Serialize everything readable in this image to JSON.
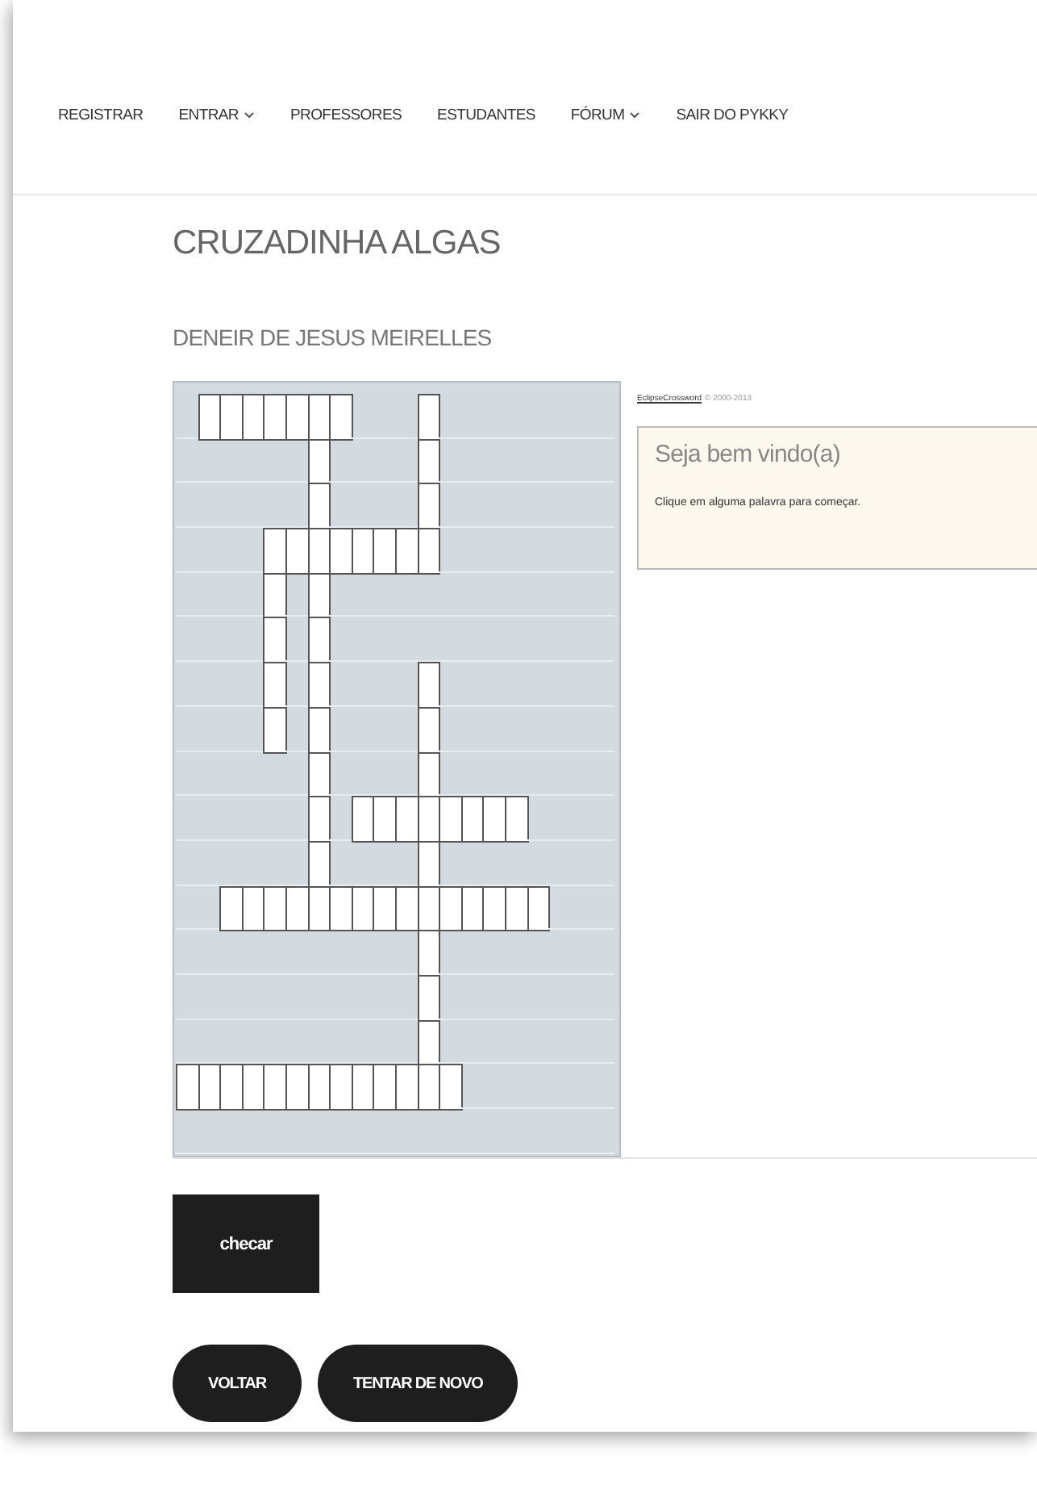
{
  "nav": [
    {
      "label": "REGISTRAR",
      "dropdown": false
    },
    {
      "label": "ENTRAR",
      "dropdown": true
    },
    {
      "label": "PROFESSORES",
      "dropdown": false
    },
    {
      "label": "ESTUDANTES",
      "dropdown": false
    },
    {
      "label": "FÓRUM",
      "dropdown": true
    },
    {
      "label": "SAIR DO PYKKY",
      "dropdown": false
    }
  ],
  "title": "CRUZADINHA ALGAS",
  "author": "DENEIR DE JESUS MEIRELLES",
  "crossword": {
    "rows": [
      [
        false,
        true,
        true,
        true,
        true,
        true,
        true,
        true,
        false,
        false,
        false,
        true,
        false,
        false,
        false,
        false,
        false,
        false,
        false,
        false
      ],
      [
        false,
        false,
        false,
        false,
        false,
        false,
        true,
        false,
        false,
        false,
        false,
        true,
        false,
        false,
        false,
        false,
        false,
        false,
        false,
        false
      ],
      [
        false,
        false,
        false,
        false,
        false,
        false,
        true,
        false,
        false,
        false,
        false,
        true,
        false,
        false,
        false,
        false,
        false,
        false,
        false,
        false
      ],
      [
        false,
        false,
        false,
        false,
        true,
        true,
        true,
        true,
        true,
        true,
        true,
        true,
        false,
        false,
        false,
        false,
        false,
        false,
        false,
        false
      ],
      [
        false,
        false,
        false,
        false,
        true,
        false,
        true,
        false,
        false,
        false,
        false,
        false,
        false,
        false,
        false,
        false,
        false,
        false,
        false,
        false
      ],
      [
        false,
        false,
        false,
        false,
        true,
        false,
        true,
        false,
        false,
        false,
        false,
        false,
        false,
        false,
        false,
        false,
        false,
        false,
        false,
        false
      ],
      [
        false,
        false,
        false,
        false,
        true,
        false,
        true,
        false,
        false,
        false,
        false,
        true,
        false,
        false,
        false,
        false,
        false,
        false,
        false,
        false
      ],
      [
        false,
        false,
        false,
        false,
        true,
        false,
        true,
        false,
        false,
        false,
        false,
        true,
        false,
        false,
        false,
        false,
        false,
        false,
        false,
        false
      ],
      [
        false,
        false,
        false,
        false,
        false,
        false,
        true,
        false,
        false,
        false,
        false,
        true,
        false,
        false,
        false,
        false,
        false,
        false,
        false,
        false
      ],
      [
        false,
        false,
        false,
        false,
        false,
        false,
        true,
        false,
        true,
        true,
        true,
        true,
        true,
        true,
        true,
        true,
        false,
        false,
        false,
        false
      ],
      [
        false,
        false,
        false,
        false,
        false,
        false,
        true,
        false,
        false,
        false,
        false,
        true,
        false,
        false,
        false,
        false,
        false,
        false,
        false,
        false
      ],
      [
        false,
        false,
        true,
        true,
        true,
        true,
        true,
        true,
        true,
        true,
        true,
        true,
        true,
        true,
        true,
        true,
        true,
        false,
        false,
        false
      ],
      [
        false,
        false,
        false,
        false,
        false,
        false,
        false,
        false,
        false,
        false,
        false,
        true,
        false,
        false,
        false,
        false,
        false,
        false,
        false,
        false
      ],
      [
        false,
        false,
        false,
        false,
        false,
        false,
        false,
        false,
        false,
        false,
        false,
        true,
        false,
        false,
        false,
        false,
        false,
        false,
        false,
        false
      ],
      [
        false,
        false,
        false,
        false,
        false,
        false,
        false,
        false,
        false,
        false,
        false,
        true,
        false,
        false,
        false,
        false,
        false,
        false,
        false,
        false
      ],
      [
        true,
        true,
        true,
        true,
        true,
        true,
        true,
        true,
        true,
        true,
        true,
        true,
        true,
        false,
        false,
        false,
        false,
        false,
        false,
        false
      ],
      [
        false,
        false,
        false,
        false,
        false,
        false,
        false,
        false,
        false,
        false,
        false,
        false,
        false,
        false,
        false,
        false,
        false,
        false,
        false,
        false
      ]
    ]
  },
  "credit": {
    "link": "EclipseCrossword",
    "text": "© 2000-2013"
  },
  "welcome": {
    "heading": "Seja bem vindo(a)",
    "message": "Clique em alguma palavra para começar."
  },
  "check_button": "checar",
  "buttons": [
    "VOLTAR",
    "TENTAR DE NOVO"
  ]
}
